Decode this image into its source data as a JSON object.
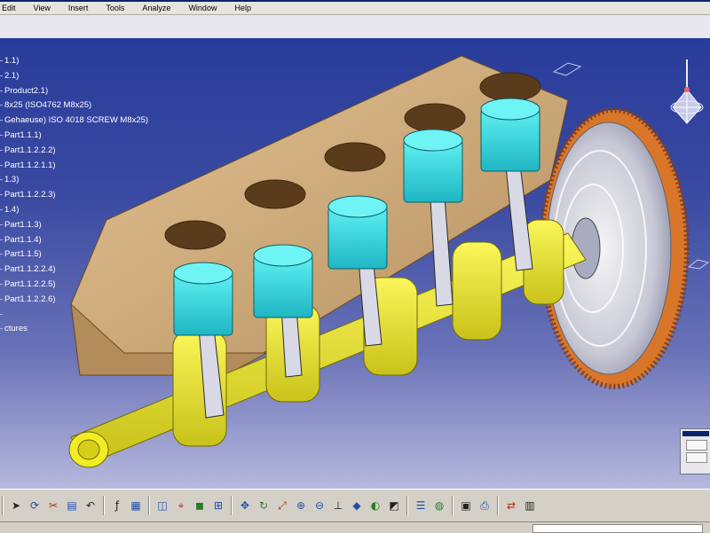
{
  "menu": [
    "Edit",
    "View",
    "Insert",
    "Tools",
    "Analyze",
    "Window",
    "Help"
  ],
  "tree": [
    "1.1)",
    "2.1)",
    "Product2.1)",
    "8x25 (ISO4762 M8x25)",
    "Gehaeuse) ISO 4018 SCREW M8x25)",
    "Part1.1.1)",
    "Part1.1.2.2.2)",
    "Part1.1.2.1.1)",
    "1.3)",
    "Part1.1.2.2.3)",
    "1.4)",
    "Part1.1.3)",
    "Part1.1.4)",
    "Part1.1.5)",
    "Part1.1.2.2.4)",
    "Part1.1.2.2.5)",
    "Part1.1.2.2.6)",
    "",
    "ctures"
  ],
  "icons": {
    "compass": "compass-icon",
    "mini_widget": "view-overview-icon",
    "toolbar": [
      [
        "select-arrow-icon",
        "refresh-icon",
        "cut-icon",
        "paste-icon",
        "undo-icon"
      ],
      [
        "formula-icon",
        "grid-icon"
      ],
      [
        "sketch-icon",
        "measure-icon",
        "box-icon",
        "snap-icon"
      ],
      [
        "pan-icon",
        "rotate-icon",
        "fit-all-icon",
        "zoom-in-icon",
        "zoom-out-icon",
        "normal-view-icon",
        "iso-view-icon",
        "shading-icon",
        "hide-show-icon"
      ],
      [
        "layer-icon",
        "material-icon"
      ],
      [
        "capture-icon",
        "print-icon"
      ],
      [
        "swap-icon",
        "catalog-icon"
      ]
    ]
  },
  "colors": {
    "viewport_top": "#283c9a",
    "viewport_bottom": "#b6b8dc",
    "engine_block": "#d8b482",
    "crankshaft": "#f2ec24",
    "piston": "#35d5da",
    "flywheel": "#d9762a"
  }
}
